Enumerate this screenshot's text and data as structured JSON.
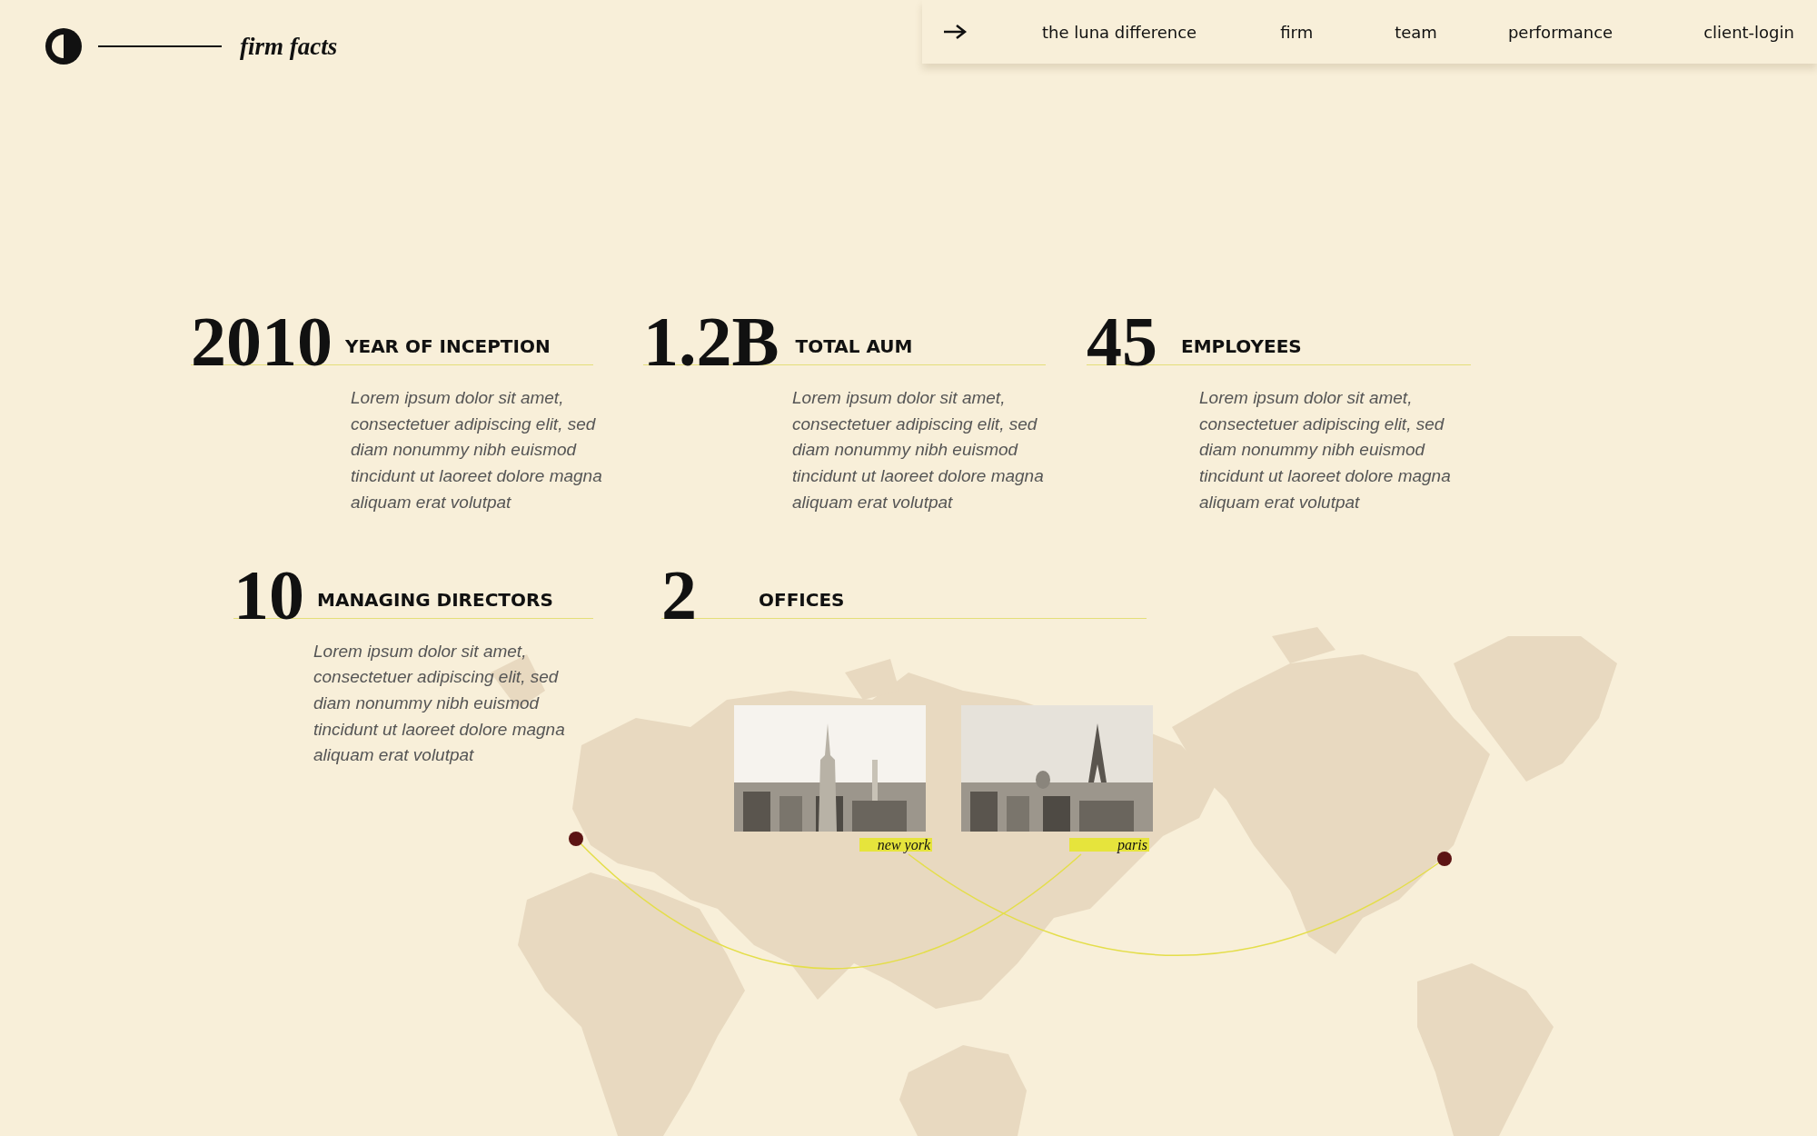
{
  "brand": {
    "title": "firm facts"
  },
  "nav": {
    "items": [
      {
        "label": "the luna difference"
      },
      {
        "label": "firm"
      },
      {
        "label": "team"
      },
      {
        "label": "performance"
      },
      {
        "label": "client-login"
      }
    ]
  },
  "stats": [
    {
      "number": "2010",
      "heading": "YEAR OF INCEPTION",
      "body": "Lorem ipsum dolor sit amet, consectetuer adipiscing elit, sed diam nonummy nibh euismod tincidunt ut laoreet dolore magna aliquam erat volutpat"
    },
    {
      "number": "1.2B",
      "heading": "TOTAL AUM",
      "body": "Lorem ipsum dolor sit amet, consectetuer adipiscing elit, sed diam nonummy nibh euismod tincidunt ut laoreet dolore magna aliquam erat volutpat"
    },
    {
      "number": "45",
      "heading": "EMPLOYEES",
      "body": "Lorem ipsum dolor sit amet, consectetuer adipiscing elit, sed diam nonummy nibh euismod tincidunt ut laoreet dolore magna aliquam erat volutpat"
    },
    {
      "number": "10",
      "heading": "MANAGING DIRECTORS",
      "body": "Lorem ipsum dolor sit amet, consectetuer adipiscing elit, sed diam nonummy nibh euismod tincidunt ut laoreet dolore magna aliquam erat volutpat"
    },
    {
      "number": "2",
      "heading": "OFFICES"
    }
  ],
  "offices": [
    {
      "name": "new york",
      "kind": "picture"
    },
    {
      "name": "paris",
      "kind": "picture"
    }
  ]
}
